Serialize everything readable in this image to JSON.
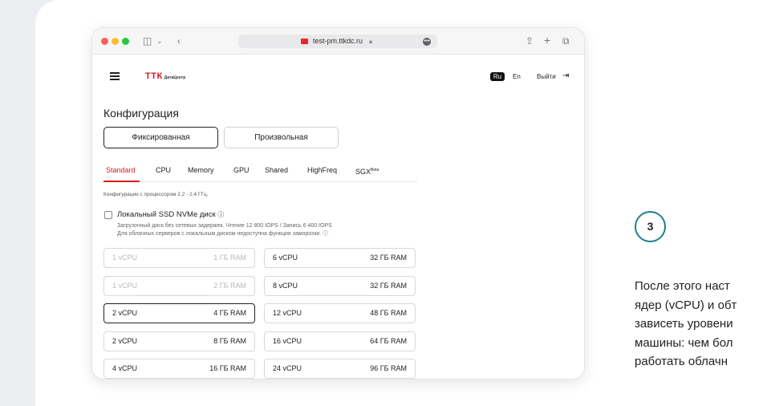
{
  "browser": {
    "url": "test-pm.ttkdc.ru",
    "lock_icon": "lock-icon"
  },
  "header": {
    "logo_main": "ТТК",
    "logo_sub": "ДатаЦентр",
    "lang_ru": "Ru",
    "lang_en": "En",
    "exit_label": "Выйти"
  },
  "page": {
    "title": "Конфигурация",
    "segments": {
      "fixed": "Фиксированная",
      "custom": "Произвольная"
    },
    "tabs": [
      "Standard",
      "CPU",
      "Memory",
      "GPU",
      "Shared",
      "HighFreq",
      "SGX"
    ],
    "sgx_sup": "Beta",
    "active_tab": "Standard",
    "cpu_note": "Конфигурации с процессором 2.2 - 2.4 ГГц.",
    "ssd_label": "Локальный SSD NVMe диск",
    "ssd_desc_1": "Загрузочный диск без сетевых задержек. Чтение 12 800 IOPS / Запись 6 400 IOPS",
    "ssd_desc_2": "Для облачных серверов с локальным диском недоступна функция заморозки.",
    "options_left": [
      {
        "cpu": "1 vCPU",
        "ram": "1 ГБ RAM",
        "state": "disabled"
      },
      {
        "cpu": "1 vCPU",
        "ram": "2 ГБ RAM",
        "state": "disabled"
      },
      {
        "cpu": "2 vCPU",
        "ram": "4 ГБ RAM",
        "state": "selected"
      },
      {
        "cpu": "2 vCPU",
        "ram": "8 ГБ RAM",
        "state": "normal"
      },
      {
        "cpu": "4 vCPU",
        "ram": "16 ГБ RAM",
        "state": "normal"
      }
    ],
    "options_right": [
      {
        "cpu": "6 vCPU",
        "ram": "32 ГБ RAM",
        "state": "normal"
      },
      {
        "cpu": "8 vCPU",
        "ram": "32 ГБ RAM",
        "state": "normal"
      },
      {
        "cpu": "12 vCPU",
        "ram": "48 ГБ RAM",
        "state": "normal"
      },
      {
        "cpu": "16 vCPU",
        "ram": "64 ГБ RAM",
        "state": "normal"
      },
      {
        "cpu": "24 vCPU",
        "ram": "96 ГБ RAM",
        "state": "normal"
      }
    ]
  },
  "step": {
    "number": "3",
    "lines": [
      "После этого наст",
      "ядер (vCPU) и обт",
      "зависеть уровени",
      "машины: чем бол",
      "работать облачн"
    ]
  },
  "colors": {
    "accent": "#d71920",
    "step_ring": "#1f7f8c"
  }
}
